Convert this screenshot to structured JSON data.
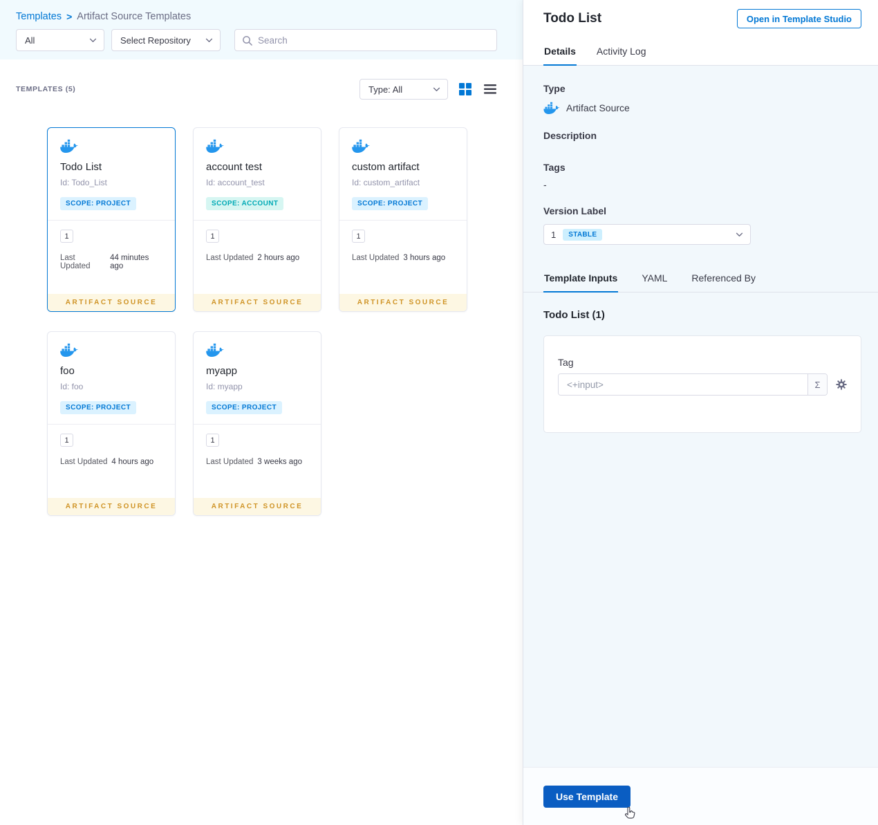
{
  "breadcrumb": {
    "templates": "Templates",
    "separator": ">",
    "current": "Artifact Source Templates"
  },
  "filters": {
    "scope_value": "All",
    "repository_label": "Select Repository",
    "search_placeholder": "Search"
  },
  "list_header": {
    "count": "TEMPLATES (5)",
    "type_filter": "Type: All"
  },
  "card_labels": {
    "last_updated": "Last Updated",
    "footer": "ARTIFACT SOURCE"
  },
  "cards": [
    {
      "title": "Todo List",
      "id": "Id: Todo_List",
      "scope_label": "SCOPE: PROJECT",
      "scope_type": "project",
      "version": "1",
      "updated": "44 minutes ago"
    },
    {
      "title": "account test",
      "id": "Id: account_test",
      "scope_label": "SCOPE: ACCOUNT",
      "scope_type": "account",
      "version": "1",
      "updated": "2 hours ago"
    },
    {
      "title": "custom artifact",
      "id": "Id: custom_artifact",
      "scope_label": "SCOPE: PROJECT",
      "scope_type": "project",
      "version": "1",
      "updated": "3 hours ago"
    },
    {
      "title": "foo",
      "id": "Id: foo",
      "scope_label": "SCOPE: PROJECT",
      "scope_type": "project",
      "version": "1",
      "updated": "4 hours ago"
    },
    {
      "title": "myapp",
      "id": "Id: myapp",
      "scope_label": "SCOPE: PROJECT",
      "scope_type": "project",
      "version": "1",
      "updated": "3 weeks ago"
    }
  ],
  "details": {
    "title": "Todo List",
    "open_studio": "Open in Template Studio",
    "tabs": {
      "details": "Details",
      "activity_log": "Activity Log"
    },
    "type_label": "Type",
    "type_value": "Artifact Source",
    "description_label": "Description",
    "tags_label": "Tags",
    "tags_value": "-",
    "version_label": "Version Label",
    "version_value": "1",
    "version_badge": "STABLE",
    "inputs_tabs": {
      "template_inputs": "Template Inputs",
      "yaml": "YAML",
      "referenced_by": "Referenced By"
    },
    "inputs_title": "Todo List (1)",
    "tag_label": "Tag",
    "tag_value": "<+input>",
    "expression_symbol": "Σ",
    "use_template": "Use Template"
  },
  "colors": {
    "accent": "#0278d5",
    "primary_button": "#0a5dc2",
    "docker_blue": "#2496ed",
    "scope_project_bg": "#dbf2ff",
    "scope_project_text": "#0278d5",
    "scope_account_bg": "#d6f6f2",
    "scope_account_text": "#00a9b5",
    "artifact_footer_bg": "#fdf7e3",
    "artifact_footer_text": "#cf9325",
    "stable_badge_bg": "#cdeffe"
  }
}
